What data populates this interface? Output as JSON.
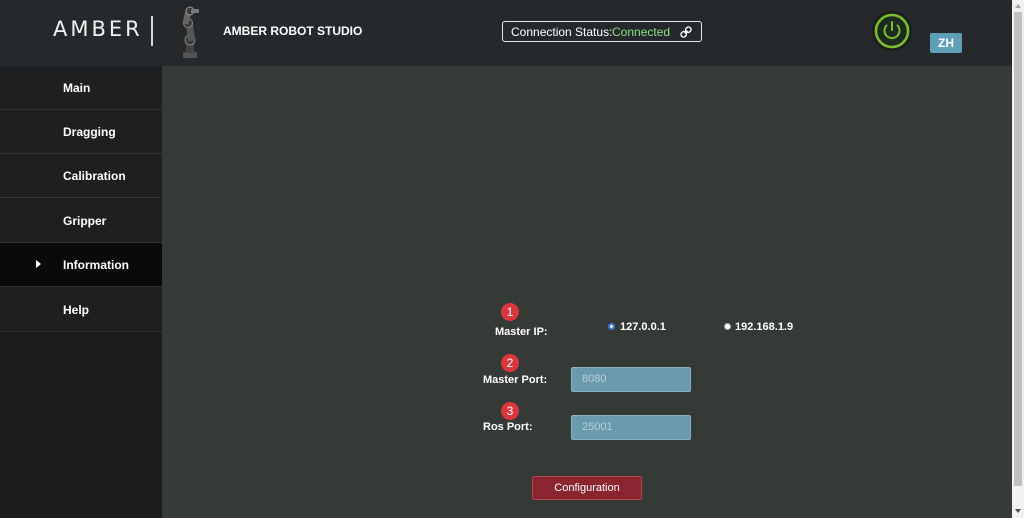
{
  "header": {
    "logo_text": "AMBER",
    "studio_title": "AMBER ROBOT STUDIO",
    "connection": {
      "label": "Connection Status:",
      "value": "Connected",
      "value_color": "#8ee08a",
      "icon": "link-icon"
    },
    "power_icon": "power-icon",
    "power_color": "#7dbb2f",
    "language_button": "ZH"
  },
  "sidebar": {
    "items": [
      {
        "label": "Main",
        "active": false
      },
      {
        "label": "Dragging",
        "active": false
      },
      {
        "label": "Calibration",
        "active": false
      },
      {
        "label": "Gripper",
        "active": false
      },
      {
        "label": "Information",
        "active": true
      },
      {
        "label": "Help",
        "active": false
      }
    ]
  },
  "form": {
    "master_ip": {
      "step": "1",
      "label": "Master IP:",
      "options": [
        "127.0.0.1",
        "192.168.1.9"
      ],
      "selected": "127.0.0.1"
    },
    "master_port": {
      "step": "2",
      "label": "Master Port:",
      "placeholder": "8080"
    },
    "ros_port": {
      "step": "3",
      "label": "Ros Port:",
      "placeholder": "25001"
    },
    "submit_label": "Configuration"
  },
  "colors": {
    "badge": "#d9363e",
    "accent_blue": "#5f9fb8",
    "button_red": "#8a2431"
  }
}
